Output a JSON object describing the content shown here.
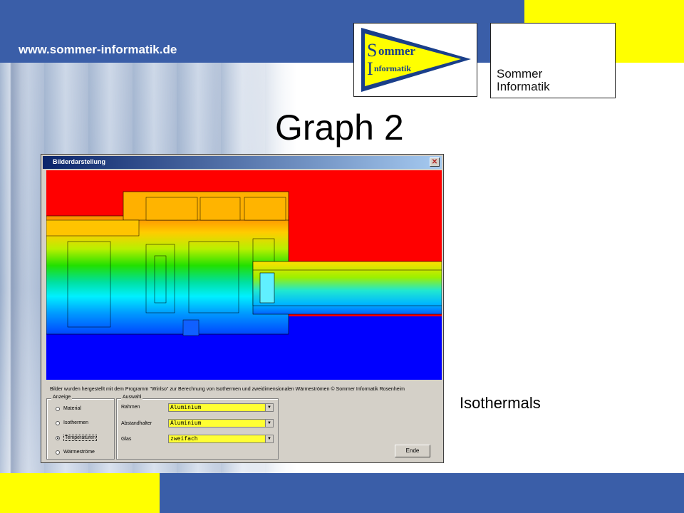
{
  "slide": {
    "url": "www.sommer-informatik.de",
    "title": "Graph 2",
    "caption": "Isothermals",
    "logo1_text": {
      "line1": "ommer",
      "line2": "nformatik",
      "s": "S",
      "i": "I"
    },
    "logo2_text": {
      "line1": "Sommer",
      "line2": "Informatik"
    }
  },
  "colors": {
    "blue": "#3a5ea8",
    "yellow": "#ffff00"
  },
  "window": {
    "title": "Bilderdarstellung",
    "close_icon": "close-icon",
    "info_text": "Bilder wurden hergestellt mit dem Programm \"Winlso\" zur Berechnung von Isothermen und zweidimensionalen Wärmeströmen © Sommer Informatik Rosenheim",
    "anzeige": {
      "legend": "Anzeige",
      "options": [
        "Material",
        "Isothermen",
        "Temperaturen",
        "Wärmeströme"
      ],
      "selected": "Temperaturen"
    },
    "auswahl": {
      "legend": "Auswahl",
      "fields": [
        {
          "label": "Rahmen",
          "value": "Aluminium"
        },
        {
          "label": "Abstandhalter",
          "value": "Aluminium"
        },
        {
          "label": "Glas",
          "value": "zweifach"
        }
      ]
    },
    "ende_button": "Ende"
  }
}
